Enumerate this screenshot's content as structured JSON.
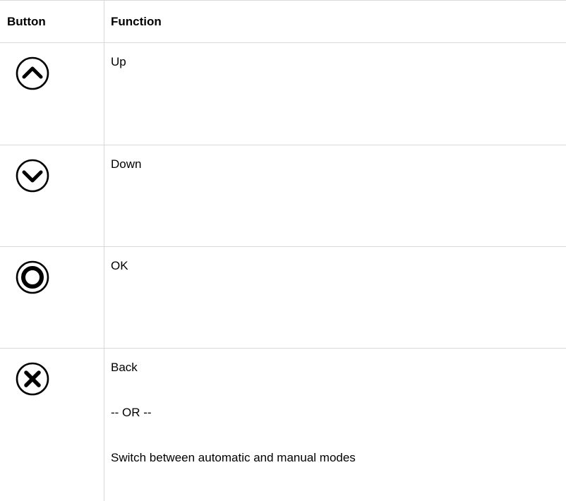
{
  "table": {
    "header": {
      "button": "Button",
      "function": "Function"
    },
    "rows": [
      {
        "icon": "up-chevron-circle-icon",
        "function": "Up"
      },
      {
        "icon": "down-chevron-circle-icon",
        "function": "Down"
      },
      {
        "icon": "ok-ring-icon",
        "function": "OK"
      },
      {
        "icon": "close-x-circle-icon",
        "function": "Back",
        "or": "-- OR --",
        "alt": "Switch between automatic and manual modes"
      }
    ]
  }
}
